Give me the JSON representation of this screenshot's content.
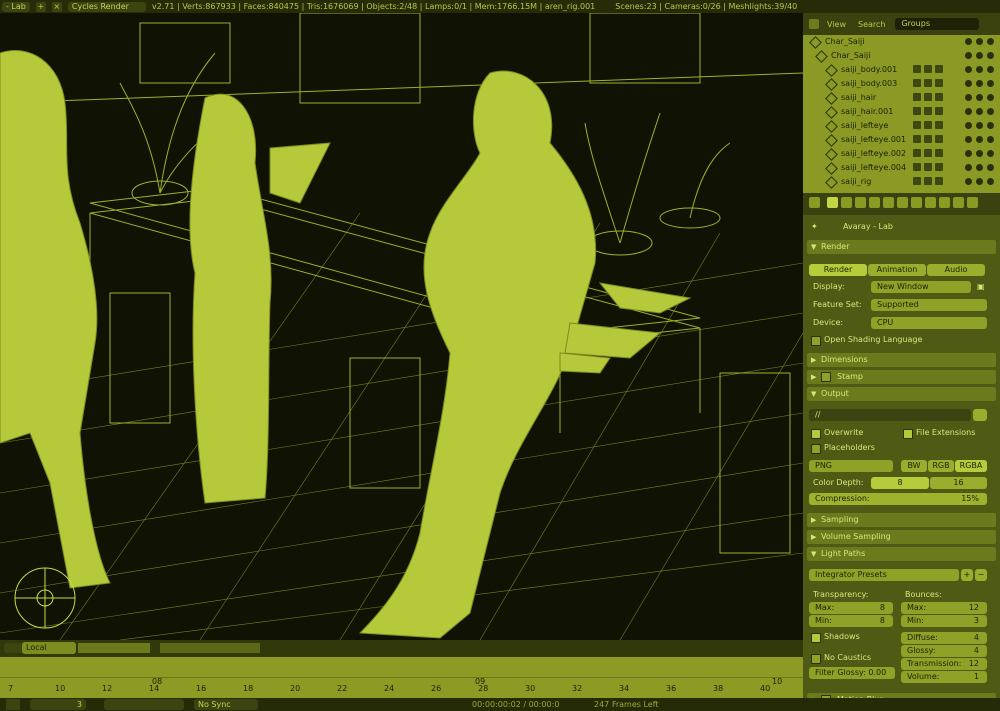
{
  "topbar": {
    "scene_name": "- Lab",
    "renderer": "Cycles Render",
    "stats": "v2.71 | Verts:867933 | Faces:840475 | Tris:1676069 | Objects:2/48 | Lamps:0/1 | Mem:1766.15M | aren_rig.001",
    "stats2": "Scenes:23 | Cameras:0/26 | Meshlights:39/40"
  },
  "outliner": {
    "view_label": "View",
    "search_label": "Search",
    "display_mode": "Groups",
    "rows": [
      {
        "label": "Char_Saiji"
      },
      {
        "label": "Char_Saiji"
      },
      {
        "label": "saiji_body.001"
      },
      {
        "label": "saiji_body.003"
      },
      {
        "label": "saiji_hair"
      },
      {
        "label": "saiji_hair.001"
      },
      {
        "label": "saiji_lefteye"
      },
      {
        "label": "saiji_lefteye.001"
      },
      {
        "label": "saiji_lefteye.002"
      },
      {
        "label": "saiji_lefteye.004"
      },
      {
        "label": "saiji_rig"
      }
    ]
  },
  "properties": {
    "scene": "Avaray - Lab",
    "render_panel": "Render",
    "render_btn": "Render",
    "animation_btn": "Animation",
    "audio_btn": "Audio",
    "display_label": "Display:",
    "display_value": "New Window",
    "feature_set_label": "Feature Set:",
    "feature_set_value": "Supported",
    "device_label": "Device:",
    "device_value": "CPU",
    "osl_label": "Open Shading Language",
    "dimensions": "Dimensions",
    "stamp": "Stamp",
    "output": "Output",
    "output_path": "//",
    "overwrite": "Overwrite",
    "file_extensions": "File Extensions",
    "placeholders": "Placeholders",
    "format": "PNG",
    "bw": "BW",
    "rgb": "RGB",
    "rgba": "RGBA",
    "color_depth_label": "Color Depth:",
    "depth_8": "8",
    "depth_16": "16",
    "compression_label": "Compression:",
    "compression_value": "15%",
    "sampling": "Sampling",
    "volume_sampling": "Volume Sampling",
    "light_paths": "Light Paths",
    "integrator_presets": "Integrator Presets",
    "transparency_label": "Transparency:",
    "bounces_label": "Bounces:",
    "t_max_label": "Max:",
    "t_max": "8",
    "t_min_label": "Min:",
    "t_min": "8",
    "b_max_label": "Max:",
    "b_max": "12",
    "b_min_label": "Min:",
    "b_min": "3",
    "shadows": "Shadows",
    "diffuse_label": "Diffuse:",
    "diffuse": "4",
    "glossy_label": "Glossy:",
    "glossy": "4",
    "transmission_label": "Transmission:",
    "transmission": "12",
    "volume_label": "Volume:",
    "volume": "1",
    "no_caustics": "No Caustics",
    "filter_glossy": "Filter Glossy: 0.00",
    "motion_blur": "Motion Blur"
  },
  "viewport_header": {
    "pivot": "Local"
  },
  "timeline": {
    "ticks": [
      "7",
      "10",
      "12",
      "14",
      "16",
      "18",
      "20",
      "22",
      "24",
      "26",
      "28",
      "30",
      "32",
      "34",
      "36",
      "38",
      "40"
    ],
    "markers": [
      "08",
      "09",
      "10"
    ],
    "footer_frame": "3",
    "sync": "No Sync",
    "timecode": "00:00:00:02 / 00:00:0",
    "frames_left": "247 Frames Left"
  },
  "colors": {
    "accent": "#b5c93a",
    "panel": "#4f5a15",
    "viewport_bg": "#101203"
  }
}
